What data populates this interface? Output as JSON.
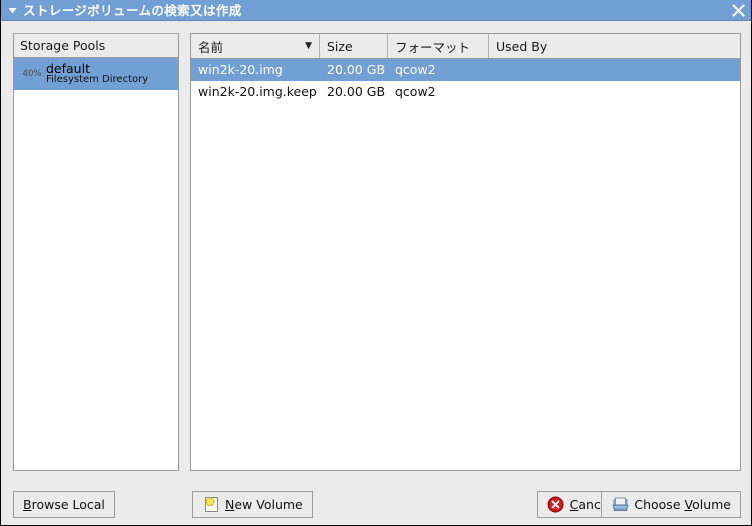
{
  "window": {
    "title": "ストレージボリュームの検索又は作成",
    "menu_icon": "triangle-down-icon",
    "close_icon": "close-icon",
    "titlebar_color": "#729fd4",
    "selection_color": "#729fd4",
    "background_color": "#ebebeb"
  },
  "pools": {
    "header": "Storage Pools",
    "items": [
      {
        "usage": "40%",
        "name": "default",
        "type": "Filesystem Directory",
        "selected": true
      }
    ]
  },
  "volumes": {
    "columns": [
      {
        "label": "名前",
        "sorted": true,
        "sort_arrow": "▼"
      },
      {
        "label": "Size",
        "sorted": false,
        "sort_arrow": ""
      },
      {
        "label": "フォーマット",
        "sorted": false,
        "sort_arrow": ""
      },
      {
        "label": "Used By",
        "sorted": false,
        "sort_arrow": ""
      }
    ],
    "rows": [
      {
        "name": "win2k-20.img",
        "size": "20.00 GB",
        "format": "qcow2",
        "used_by": "",
        "selected": true
      },
      {
        "name": "win2k-20.img.keep",
        "size": "20.00 GB",
        "format": "qcow2",
        "used_by": "",
        "selected": false
      }
    ]
  },
  "buttons": {
    "browse_local": {
      "prefix": "",
      "mnemonic": "B",
      "suffix": "rowse Local"
    },
    "new_volume": {
      "prefix": "",
      "mnemonic": "N",
      "suffix": "ew Volume",
      "icon": "new-document-icon"
    },
    "cancel": {
      "prefix": "",
      "mnemonic": "C",
      "suffix": "ancel",
      "icon": "cancel-icon"
    },
    "choose_volume": {
      "prefix": "Choose ",
      "mnemonic": "V",
      "suffix": "olume",
      "icon": "volume-tray-icon"
    }
  }
}
